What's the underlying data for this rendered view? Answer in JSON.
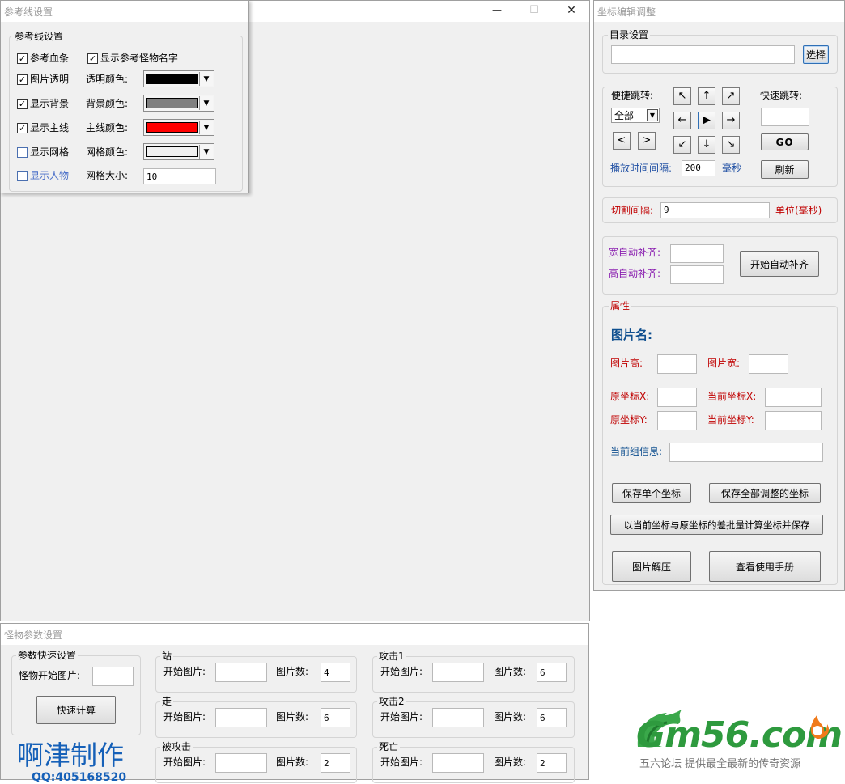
{
  "colors": {
    "red": "#c00000",
    "blue": "#1f4fa3",
    "purple": "#8a1fb0",
    "navy": "#0f4f8f",
    "black_swatch": "#000000",
    "gray_swatch": "#808080",
    "red_swatch": "#ff0000",
    "grid_swatch": "#f0f0f0"
  },
  "main_window": {
    "close_icon": "✕",
    "maximize_icon": "☐",
    "minimize_icon": "—"
  },
  "ref_window": {
    "title": "参考线设置",
    "group_label": "参考线设置",
    "chk_blood": "参考血条",
    "chk_monster_name": "显示参考怪物名字",
    "chk_transparent": "图片透明",
    "lbl_transparent_color": "透明颜色:",
    "chk_background": "显示背景",
    "lbl_background_color": "背景颜色:",
    "chk_mainline": "显示主线",
    "lbl_mainline_color": "主线颜色:",
    "chk_grid": "显示网格",
    "lbl_grid_color": "网格颜色:",
    "chk_person": "显示人物",
    "lbl_grid_size": "网格大小:",
    "grid_size_value": "10"
  },
  "coord_window": {
    "title": "坐标编辑调整",
    "dir_group": "目录设置",
    "dir_value": "",
    "select_button": "选择",
    "quick_jump_label": "便捷跳转:",
    "quick_jump_select": "全部",
    "fast_jump_label": "快速跳转:",
    "fast_jump_value": "",
    "go_button": "GO",
    "interval_label": "播放时间间隔:",
    "interval_value": "200",
    "interval_unit": "毫秒",
    "refresh_button": "刷新",
    "prev_button": "<",
    "next_button": ">",
    "arrows": {
      "up_left": "↖",
      "up": "↑",
      "up_right": "↗",
      "left": "←",
      "play": "▶",
      "right": "→",
      "down_left": "↙",
      "down": "↓",
      "down_right": "↘"
    },
    "cut_label": "切割间隔:",
    "cut_value": "9",
    "cut_unit": "单位(毫秒)",
    "width_auto_label": "宽自动补齐:",
    "height_auto_label": "高自动补齐:",
    "auto_button": "开始自动补齐",
    "attr_group": "属性",
    "image_name_label": "图片名:",
    "img_height_label": "图片高:",
    "img_width_label": "图片宽:",
    "orig_x_label": "原坐标X:",
    "cur_x_label": "当前坐标X:",
    "orig_y_label": "原坐标Y:",
    "cur_y_label": "当前坐标Y:",
    "group_info_label": "当前组信息:",
    "save_single_button": "保存单个坐标",
    "save_all_button": "保存全部调整的坐标",
    "batch_button": "以当前坐标与原坐标的差批量计算坐标并保存",
    "decompress_button": "图片解压",
    "manual_button": "查看使用手册"
  },
  "monster_window": {
    "title": "怪物参数设置",
    "quick_group": "参数快速设置",
    "start_image_label": "怪物开始图片:",
    "quick_calc_button": "快速计算",
    "author_text": "啊津制作",
    "qq_text": "QQ:405168520",
    "start_label": "开始图片:",
    "count_label": "图片数:",
    "actions": [
      {
        "name": "站",
        "count": "4"
      },
      {
        "name": "走",
        "count": "6"
      },
      {
        "name": "被攻击",
        "count": "2"
      },
      {
        "name": "攻击1",
        "count": "6"
      },
      {
        "name": "攻击2",
        "count": "6"
      },
      {
        "name": "死亡",
        "count": "2"
      }
    ]
  },
  "watermark": {
    "logo_text": "Gm56.com",
    "slogan": "五六论坛 提供最全最新的传奇资源"
  }
}
